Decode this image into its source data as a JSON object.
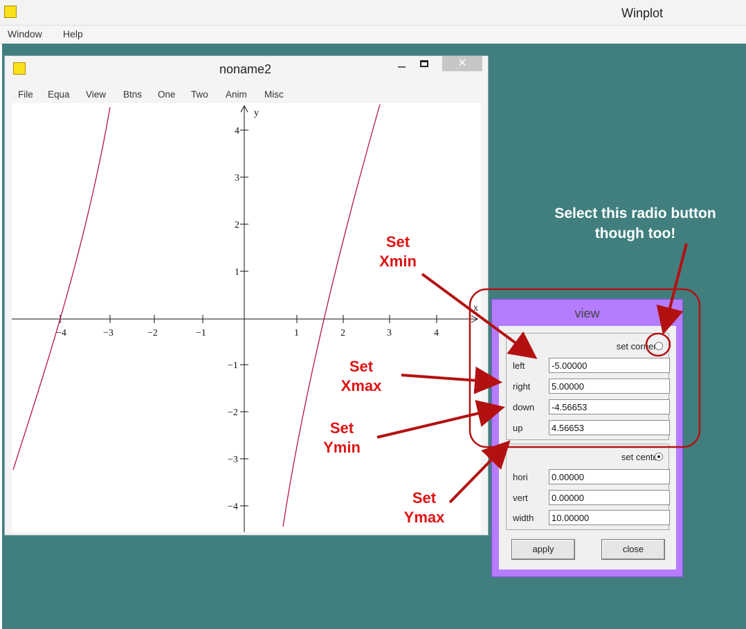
{
  "app": {
    "title": "Winplot",
    "menu": [
      "Window",
      "Help"
    ],
    "icon": "winplot-icon"
  },
  "plot_window": {
    "title": "noname2",
    "menu": [
      "File",
      "Equa",
      "View",
      "Btns",
      "One",
      "Two",
      "Anim",
      "Misc"
    ],
    "controls": {
      "minimize": "–",
      "close": "✕"
    },
    "axes": {
      "x_label": "x",
      "y_label": "y",
      "x_ticks": [
        "−4",
        "−3",
        "−2",
        "−1",
        "1",
        "2",
        "3",
        "4"
      ],
      "y_ticks": [
        "4",
        "3",
        "2",
        "1",
        "−1",
        "−2",
        "−3",
        "−4"
      ]
    },
    "curve_color": "#b0003a"
  },
  "view_dialog": {
    "title": "view",
    "set_corners_label": "set corners",
    "set_corners_checked": false,
    "fields_corners": [
      {
        "label": "left",
        "value": "-5.00000"
      },
      {
        "label": "right",
        "value": "5.00000"
      },
      {
        "label": "down",
        "value": "-4.56653"
      },
      {
        "label": "up",
        "value": "4.56653"
      }
    ],
    "set_center_label": "set center",
    "set_center_checked": true,
    "fields_center": [
      {
        "label": "hori",
        "value": "0.00000"
      },
      {
        "label": "vert",
        "value": "0.00000"
      },
      {
        "label": "width",
        "value": "10.00000"
      }
    ],
    "apply_label": "apply",
    "close_label": "close"
  },
  "annotations": {
    "radio_note": "Select this radio button though too!",
    "xmin": "Set Xmin",
    "xmax": "Set Xmax",
    "ymin": "Set Ymin",
    "ymax": "Set Ymax"
  },
  "colors": {
    "desktop": "#417f7f",
    "dialog_accent": "#b57cff",
    "annotation_red": "#dd1414",
    "highlight_border": "#b31111"
  }
}
